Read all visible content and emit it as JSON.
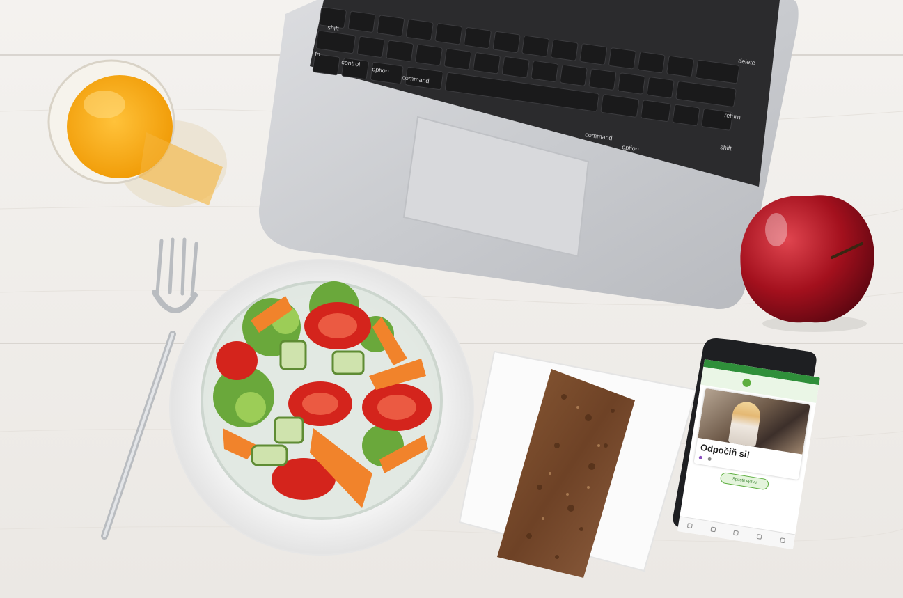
{
  "phone": {
    "statusbar": "",
    "title": "Odpočiň si!",
    "cta_label": "Spustit výzvu"
  }
}
